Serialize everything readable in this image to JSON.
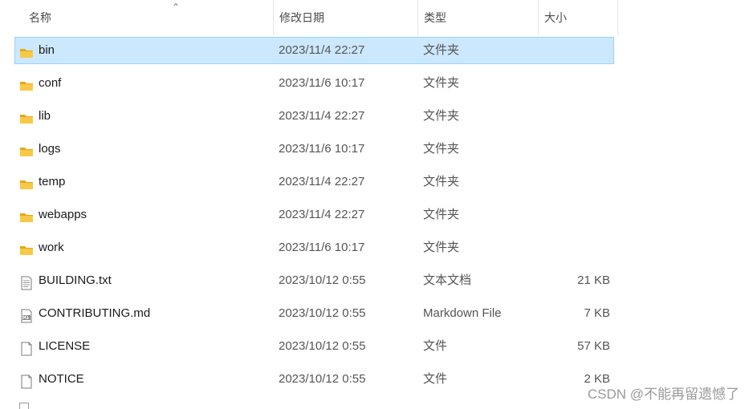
{
  "columns": {
    "name": "名称",
    "date": "修改日期",
    "type": "类型",
    "size": "大小"
  },
  "sort_indicator": "up-caret",
  "selected_row": 0,
  "files": [
    {
      "name": "bin",
      "date": "2023/11/4 22:27",
      "type": "文件夹",
      "size": "",
      "icon": "folder-icon"
    },
    {
      "name": "conf",
      "date": "2023/11/6 10:17",
      "type": "文件夹",
      "size": "",
      "icon": "folder-icon"
    },
    {
      "name": "lib",
      "date": "2023/11/4 22:27",
      "type": "文件夹",
      "size": "",
      "icon": "folder-icon"
    },
    {
      "name": "logs",
      "date": "2023/11/6 10:17",
      "type": "文件夹",
      "size": "",
      "icon": "folder-icon"
    },
    {
      "name": "temp",
      "date": "2023/11/4 22:27",
      "type": "文件夹",
      "size": "",
      "icon": "folder-icon"
    },
    {
      "name": "webapps",
      "date": "2023/11/4 22:27",
      "type": "文件夹",
      "size": "",
      "icon": "folder-icon"
    },
    {
      "name": "work",
      "date": "2023/11/6 10:17",
      "type": "文件夹",
      "size": "",
      "icon": "folder-icon"
    },
    {
      "name": "BUILDING.txt",
      "date": "2023/10/12 0:55",
      "type": "文本文档",
      "size": "21 KB",
      "icon": "text-document-icon"
    },
    {
      "name": "CONTRIBUTING.md",
      "date": "2023/10/12 0:55",
      "type": "Markdown File",
      "size": "7 KB",
      "icon": "markdown-file-icon"
    },
    {
      "name": "LICENSE",
      "date": "2023/10/12 0:55",
      "type": "文件",
      "size": "57 KB",
      "icon": "blank-file-icon"
    },
    {
      "name": "NOTICE",
      "date": "2023/10/12 0:55",
      "type": "文件",
      "size": "2 KB",
      "icon": "blank-file-icon"
    }
  ],
  "watermark": "CSDN @不能再留遗憾了",
  "colors": {
    "selection_fill": "#cce8ff",
    "selection_border": "#99d1ff",
    "folder_yellow": "#f8c946",
    "folder_dark": "#e5a718"
  }
}
